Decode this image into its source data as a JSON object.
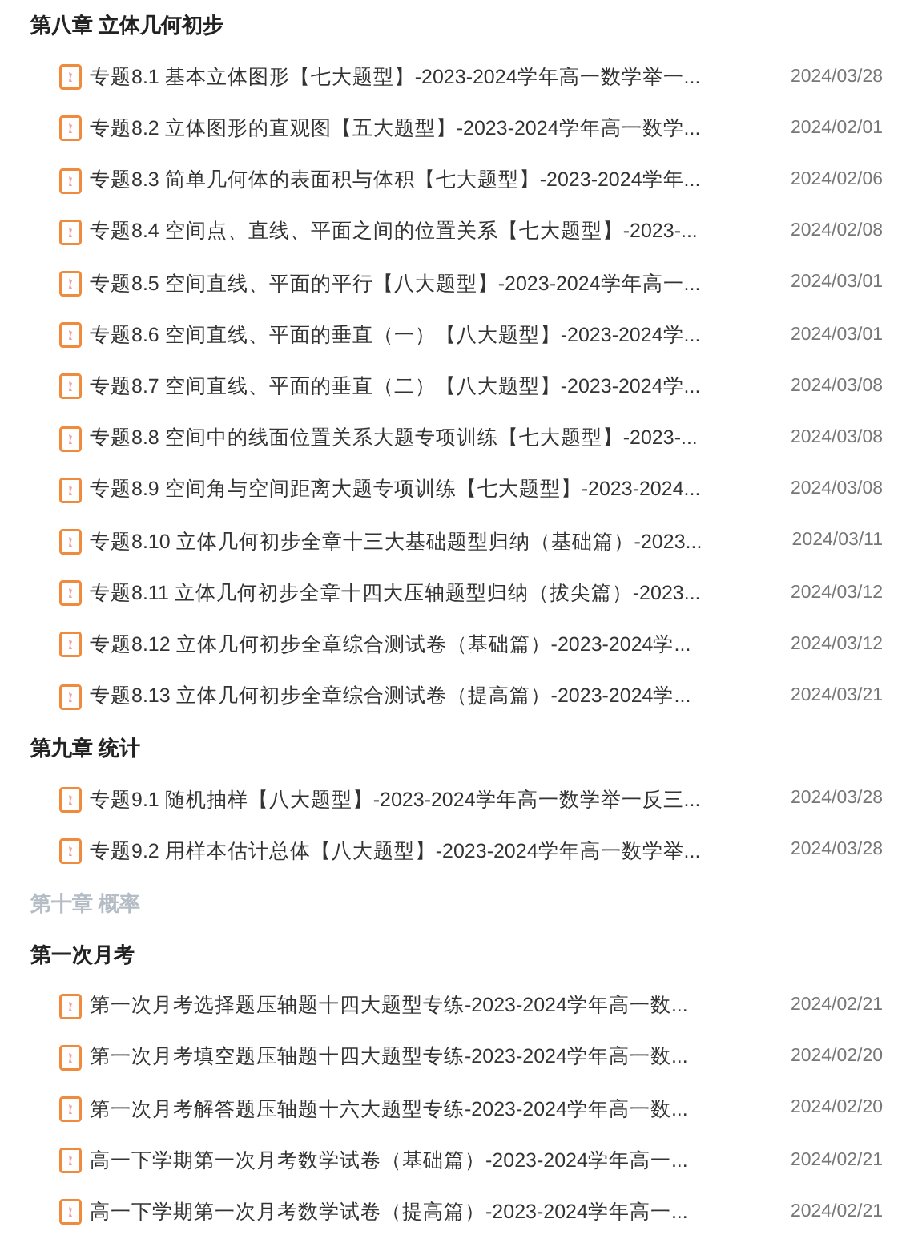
{
  "sections": [
    {
      "title": "第八章 立体几何初步",
      "disabled": false,
      "items": [
        {
          "title": "专题8.1 基本立体图形【七大题型】-2023-2024学年高一数学举一...",
          "date": "2024/03/28"
        },
        {
          "title": "专题8.2 立体图形的直观图【五大题型】-2023-2024学年高一数学...",
          "date": "2024/02/01"
        },
        {
          "title": "专题8.3 简单几何体的表面积与体积【七大题型】-2023-2024学年...",
          "date": "2024/02/06"
        },
        {
          "title": "专题8.4 空间点、直线、平面之间的位置关系【七大题型】-2023-...",
          "date": "2024/02/08"
        },
        {
          "title": "专题8.5 空间直线、平面的平行【八大题型】-2023-2024学年高一...",
          "date": "2024/03/01"
        },
        {
          "title": "专题8.6 空间直线、平面的垂直（一）【八大题型】-2023-2024学...",
          "date": "2024/03/01"
        },
        {
          "title": "专题8.7 空间直线、平面的垂直（二）【八大题型】-2023-2024学...",
          "date": "2024/03/08"
        },
        {
          "title": "专题8.8 空间中的线面位置关系大题专项训练【七大题型】-2023-...",
          "date": "2024/03/08"
        },
        {
          "title": "专题8.9 空间角与空间距离大题专项训练【七大题型】-2023-2024...",
          "date": "2024/03/08"
        },
        {
          "title": "专题8.10 立体几何初步全章十三大基础题型归纳（基础篇）-2023...",
          "date": "2024/03/11"
        },
        {
          "title": "专题8.11 立体几何初步全章十四大压轴题型归纳（拔尖篇）-2023...",
          "date": "2024/03/12"
        },
        {
          "title": "专题8.12 立体几何初步全章综合测试卷（基础篇）-2023-2024学...",
          "date": "2024/03/12"
        },
        {
          "title": "专题8.13 立体几何初步全章综合测试卷（提高篇）-2023-2024学...",
          "date": "2024/03/21"
        }
      ]
    },
    {
      "title": "第九章 统计",
      "disabled": false,
      "items": [
        {
          "title": "专题9.1 随机抽样【八大题型】-2023-2024学年高一数学举一反三...",
          "date": "2024/03/28"
        },
        {
          "title": "专题9.2 用样本估计总体【八大题型】-2023-2024学年高一数学举...",
          "date": "2024/03/28"
        }
      ]
    },
    {
      "title": "第十章 概率",
      "disabled": true
    },
    {
      "title": "第一次月考",
      "disabled": false,
      "items": [
        {
          "title": "第一次月考选择题压轴题十四大题型专练-2023-2024学年高一数...",
          "date": "2024/02/21"
        },
        {
          "title": "第一次月考填空题压轴题十四大题型专练-2023-2024学年高一数...",
          "date": "2024/02/20"
        },
        {
          "title": "第一次月考解答题压轴题十六大题型专练-2023-2024学年高一数...",
          "date": "2024/02/20"
        },
        {
          "title": "高一下学期第一次月考数学试卷（基础篇）-2023-2024学年高一...",
          "date": "2024/02/21"
        },
        {
          "title": "高一下学期第一次月考数学试卷（提高篇）-2023-2024学年高一...",
          "date": "2024/02/21"
        }
      ]
    }
  ]
}
